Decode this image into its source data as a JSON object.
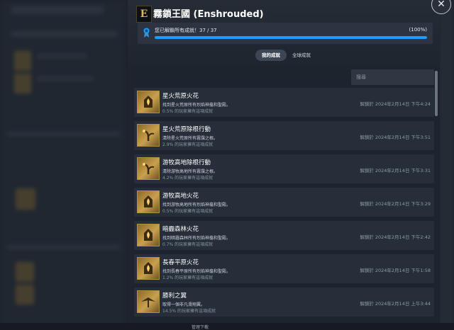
{
  "game": {
    "title": "霧鎖王國 (Enshrouded)",
    "logo_letter": "E"
  },
  "progress": {
    "text": "您已解鎖所有成就！37 / 37",
    "percent_label": "(100%)",
    "fraction": 1.0
  },
  "tabs": [
    {
      "label": "我的成就",
      "active": true
    },
    {
      "label": "全球成就",
      "active": false
    }
  ],
  "search": {
    "placeholder": "搜尋"
  },
  "achievements": [
    {
      "name": "星火荒原火花",
      "description": "找到星火荒原所有烈焰神龕和聖殿。",
      "percent": "0.5% 的玩家擁有這項成就",
      "unlocked": "解鎖於 2024年2月14日 下午4:24",
      "icon": "flame-shrine-icon"
    },
    {
      "name": "星火荒原除根行動",
      "description": "清除星火荒原所有霧靄之根。",
      "percent": "2.9% 的玩家擁有這項成就",
      "unlocked": "解鎖於 2024年2月14日 下午3:51",
      "icon": "root-icon"
    },
    {
      "name": "游牧高地除根行動",
      "description": "清除游牧高地所有霧靄之根。",
      "percent": "4.2% 的玩家擁有這項成就",
      "unlocked": "解鎖於 2024年2月14日 下午3:31",
      "icon": "root-icon"
    },
    {
      "name": "游牧高地火花",
      "description": "找到游牧高地所有烈焰神龕和聖殿。",
      "percent": "0.5% 的玩家擁有這項成就",
      "unlocked": "解鎖於 2024年2月14日 下午3:29",
      "icon": "flame-shrine-icon"
    },
    {
      "name": "暗霾森林火花",
      "description": "找到暗霾森林所有烈焰神龕和聖殿。",
      "percent": "0.7% 的玩家擁有這項成就",
      "unlocked": "解鎖於 2024年2月14日 下午2:42",
      "icon": "flame-shrine-icon"
    },
    {
      "name": "長春平原火花",
      "description": "找到長春平原所有烈焰神龕和聖殿。",
      "percent": "1.2% 的玩家擁有這項成就",
      "unlocked": "解鎖於 2024年2月14日 下午1:58",
      "icon": "flame-shrine-icon"
    },
    {
      "name": "勝利之翼",
      "description": "取得一個非凡滑翔翼。",
      "percent": "14.5% 的玩家擁有這項成就",
      "unlocked": "解鎖於 2024年2月14日 上午3:44",
      "icon": "glider-wing-icon"
    }
  ],
  "footer": {
    "label": "管理下載"
  },
  "colors": {
    "accent": "#1a9fff",
    "gold": "#c9a04e"
  }
}
